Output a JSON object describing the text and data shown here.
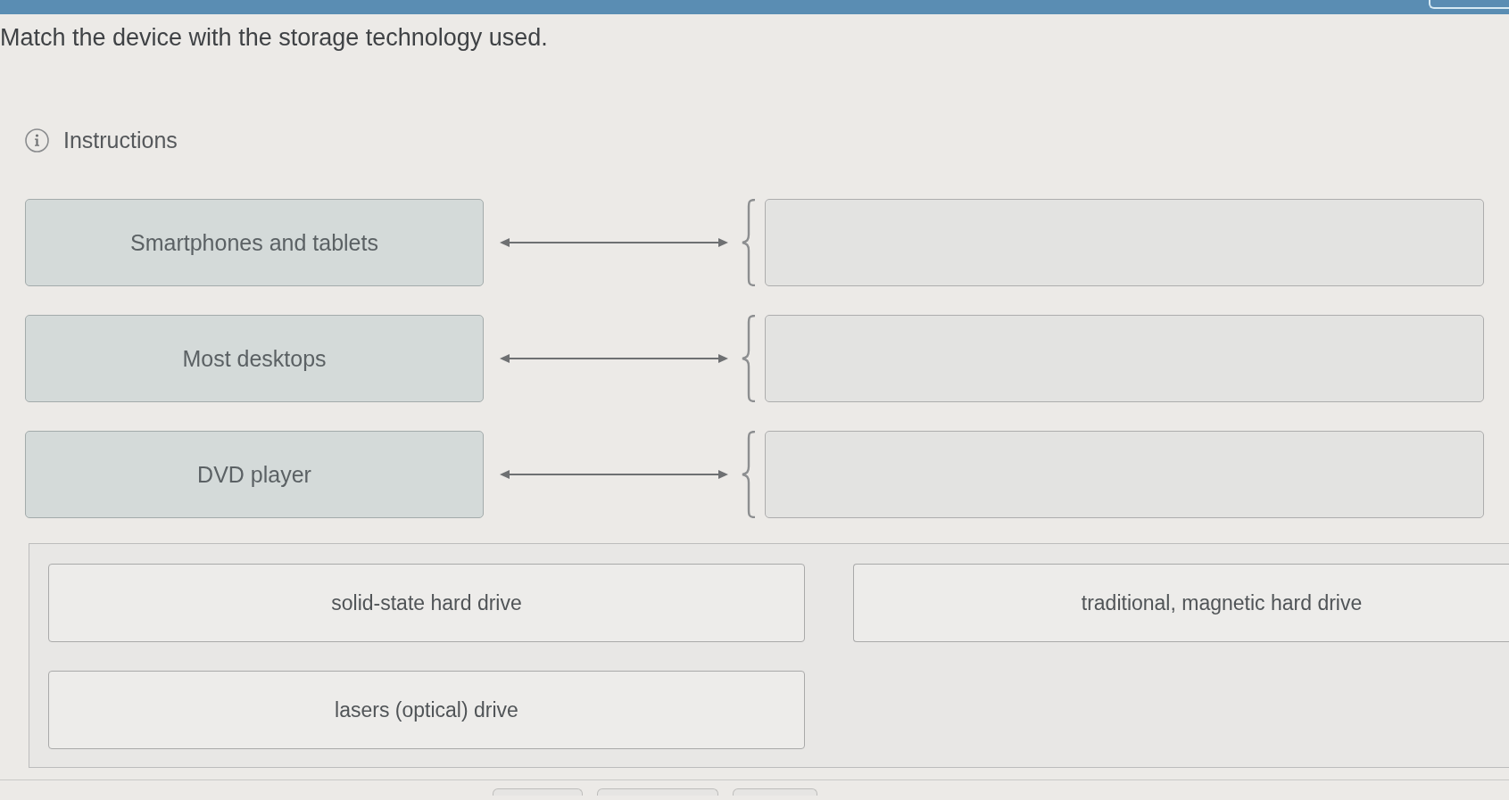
{
  "question": "Match the device with the storage technology used.",
  "instructions": {
    "label": "Instructions"
  },
  "pairs": [
    {
      "prompt": "Smartphones and tablets"
    },
    {
      "prompt": "Most desktops"
    },
    {
      "prompt": "DVD player"
    }
  ],
  "answer_bank": [
    "solid-state hard drive",
    "traditional, magnetic hard drive",
    "lasers (optical) drive"
  ]
}
